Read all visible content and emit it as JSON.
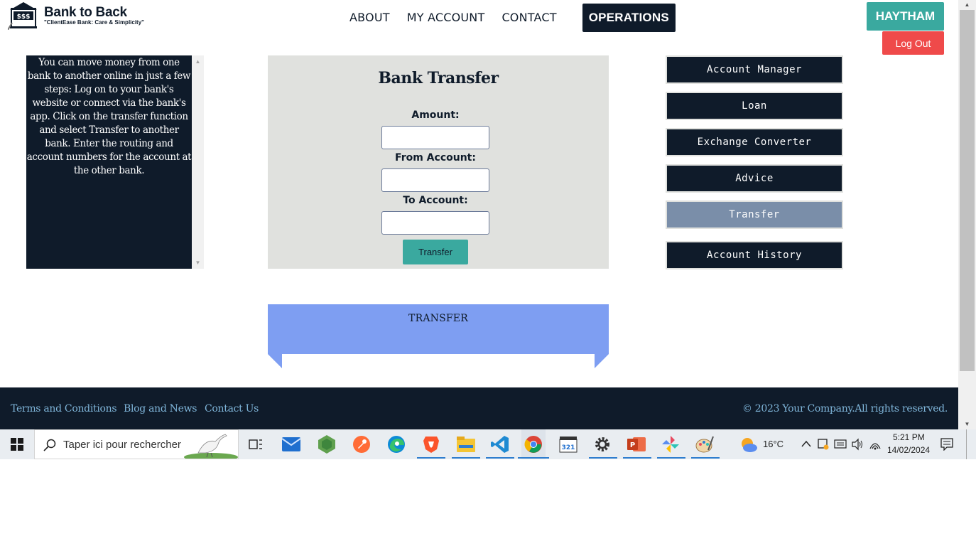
{
  "header": {
    "brand_title": "Bank to Back",
    "brand_tagline": "\"ClientEase Bank:  Care & Simplicity\"",
    "nav": [
      "ABOUT",
      "MY ACCOUNT",
      "CONTACT"
    ],
    "nav_active": "OPERATIONS",
    "user_name": "HAYTHAM",
    "logout_label": "Log Out"
  },
  "info_text": "You can move money from one bank to another online in just a few steps: Log on to your bank's website or connect via the bank's app. Click on the transfer function and select Transfer to another bank. Enter the routing and account numbers for the account at the other bank.",
  "form": {
    "title": "Bank Transfer",
    "amount_label": "Amount:",
    "amount_value": "",
    "from_label": "From Account:",
    "from_value": "",
    "to_label": "To Account:",
    "to_value": "",
    "submit_label": "Transfer"
  },
  "menu": {
    "items": [
      "Account Manager",
      "Loan",
      "Exchange Converter",
      "Advice",
      "Transfer",
      "Account History"
    ],
    "current": "Transfer"
  },
  "banner": {
    "text": "TRANSFER"
  },
  "footer": {
    "links": [
      "Terms and Conditions",
      "Blog and News",
      "Contact Us"
    ],
    "copyright": "© 2023 Your Company.All rights reserved."
  },
  "taskbar": {
    "search_placeholder": "Taper ici pour rechercher",
    "weather": "16°C",
    "time": "5:21 PM",
    "date": "14/02/2024",
    "apps": [
      "task-view",
      "mail",
      "node",
      "postman",
      "edge",
      "brave",
      "file-explorer",
      "vscode",
      "chrome",
      "clapper",
      "settings",
      "powerpoint",
      "pinwheel",
      "paint"
    ]
  },
  "colors": {
    "navy": "#0f1b2a",
    "teal": "#3aa99f",
    "red": "#ef4a4a",
    "banner_blue": "#7e9ef2",
    "menu_active": "#7a8ea9",
    "form_bg": "#e0e1de"
  }
}
